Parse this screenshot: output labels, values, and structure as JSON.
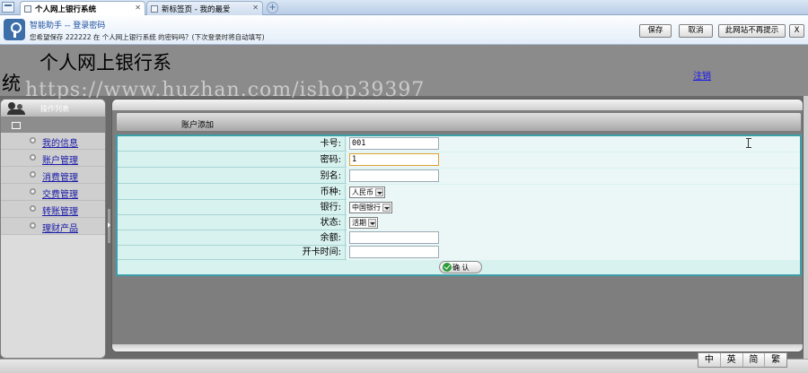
{
  "browser": {
    "tabs": [
      {
        "label": "个人网上银行系统",
        "active": true
      },
      {
        "label": "新标签页 - 我的最爱",
        "active": false
      }
    ],
    "new_tab": "+"
  },
  "assistant": {
    "title": "智能助手 -- 登录密码",
    "message": "您希望保存 222222 在 个人网上银行系统 的密码吗？(下次登录时将自动填写)",
    "buttons": {
      "save": "保存",
      "cancel": "取消",
      "never": "此网站不再提示",
      "close": "X"
    }
  },
  "header": {
    "title_line1": "个人网上银行系",
    "title_line2": "统",
    "logout": "注销",
    "watermark": "https://www.huzhan.com/ishop39397"
  },
  "sidebar": {
    "title": "操作列表",
    "items": [
      {
        "label": "我的信息"
      },
      {
        "label": "账户管理"
      },
      {
        "label": "消费管理"
      },
      {
        "label": "交费管理"
      },
      {
        "label": "转账管理"
      },
      {
        "label": "理财产品"
      }
    ]
  },
  "main": {
    "section_title": "账户添加",
    "form": {
      "card_no": {
        "label": "卡号:",
        "value": "001"
      },
      "password": {
        "label": "密码:",
        "value": "1"
      },
      "alias": {
        "label": "别名:",
        "value": ""
      },
      "currency": {
        "label": "币种:",
        "value": "人民币"
      },
      "bank": {
        "label": "银行:",
        "value": "中国银行"
      },
      "status": {
        "label": "状态:",
        "value": "活期"
      },
      "balance": {
        "label": "余额:",
        "value": ""
      },
      "open_time": {
        "label": "开卡时间:",
        "value": ""
      }
    },
    "confirm": "确 认"
  },
  "ime": [
    "中",
    "英",
    "简",
    "繁"
  ],
  "colors": {
    "form_border": "#3a9fa8",
    "form_bg": "#d8f2ef",
    "link": "#1a1aee"
  }
}
